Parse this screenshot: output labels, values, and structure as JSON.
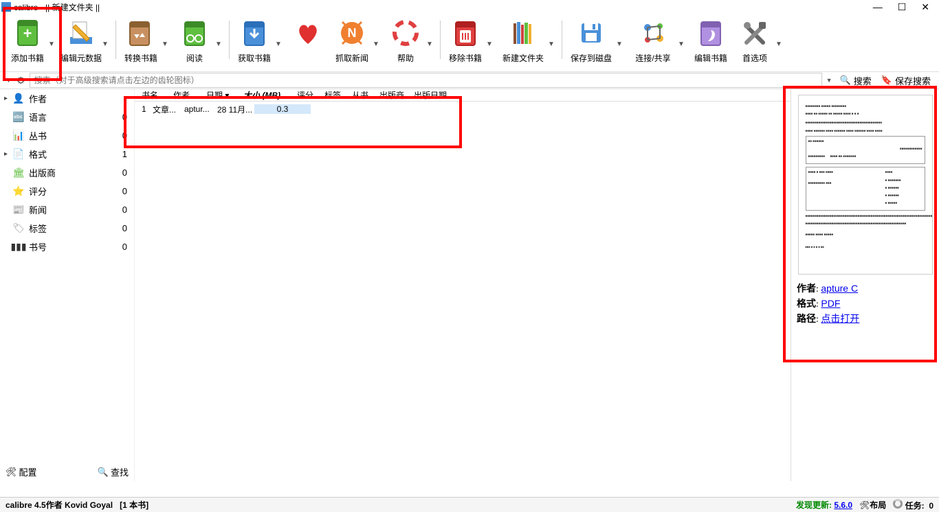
{
  "title": "calibre - || 新建文件夹 ||",
  "window_controls": {
    "min": "—",
    "max": "☐",
    "close": "✕"
  },
  "toolbar": [
    {
      "id": "add",
      "label": "添加书籍",
      "drop": true
    },
    {
      "id": "meta",
      "label": "编辑元数据",
      "drop": true,
      "sep": true
    },
    {
      "id": "convert",
      "label": "转换书籍",
      "drop": true
    },
    {
      "id": "read",
      "label": "阅读",
      "drop": true,
      "sep": true
    },
    {
      "id": "fetch",
      "label": "获取书籍",
      "drop": true
    },
    {
      "id": "heart",
      "label": "",
      "drop": false
    },
    {
      "id": "news",
      "label": "抓取新闻",
      "drop": true
    },
    {
      "id": "help",
      "label": "帮助",
      "drop": true,
      "sep": true
    },
    {
      "id": "remove",
      "label": "移除书籍",
      "drop": true
    },
    {
      "id": "newfolder",
      "label": "新建文件夹",
      "drop": true,
      "wide": true,
      "sep": true
    },
    {
      "id": "save",
      "label": "保存到磁盘",
      "drop": true,
      "wide": true
    },
    {
      "id": "share",
      "label": "连接/共享",
      "drop": true,
      "wide": true
    },
    {
      "id": "edit",
      "label": "编辑书籍"
    },
    {
      "id": "prefs",
      "label": "首选项",
      "drop": true
    }
  ],
  "search": {
    "placeholder": "搜索（对于高级搜索请点击左边的齿轮图标）",
    "go": "搜索",
    "save": "保存搜索"
  },
  "sidebar": {
    "items": [
      {
        "chev": "▸",
        "icon": "author",
        "label": "作者",
        "count": ""
      },
      {
        "chev": "",
        "icon": "lang",
        "label": "语言",
        "count": "0"
      },
      {
        "chev": "",
        "icon": "series",
        "label": "丛书",
        "count": "0"
      },
      {
        "chev": "▸",
        "icon": "format",
        "label": "格式",
        "count": "1"
      },
      {
        "chev": "",
        "icon": "publisher",
        "label": "出版商",
        "count": "0"
      },
      {
        "chev": "",
        "icon": "rating",
        "label": "评分",
        "count": "0"
      },
      {
        "chev": "",
        "icon": "newscat",
        "label": "新闻",
        "count": "0"
      },
      {
        "chev": "",
        "icon": "tags",
        "label": "标签",
        "count": "0"
      },
      {
        "chev": "",
        "icon": "id",
        "label": "书号",
        "count": "0"
      }
    ],
    "config": "配置",
    "find": "查找"
  },
  "headers": [
    "书名",
    "作者",
    "日期 ▾",
    "大小 (MB)",
    "评分",
    "标签",
    "从书",
    "出版商",
    "出版日期"
  ],
  "rows": [
    {
      "n": "1",
      "title": "文章...",
      "author": "aptur...",
      "date": "28 11月...",
      "size": "0.3"
    }
  ],
  "details": {
    "author_k": "作者",
    "author_v": "apture C",
    "format_k": "格式",
    "format_v": "PDF",
    "path_k": "路径",
    "path_v": "点击打开"
  },
  "status": {
    "app": "calibre 4.5作者 Kovid Goyal",
    "count": "[1 本书]",
    "update_pre": "发现更新:",
    "update_ver": "5.6.0",
    "layout": "布局",
    "jobs": "任务:",
    "jobs_n": "0"
  }
}
